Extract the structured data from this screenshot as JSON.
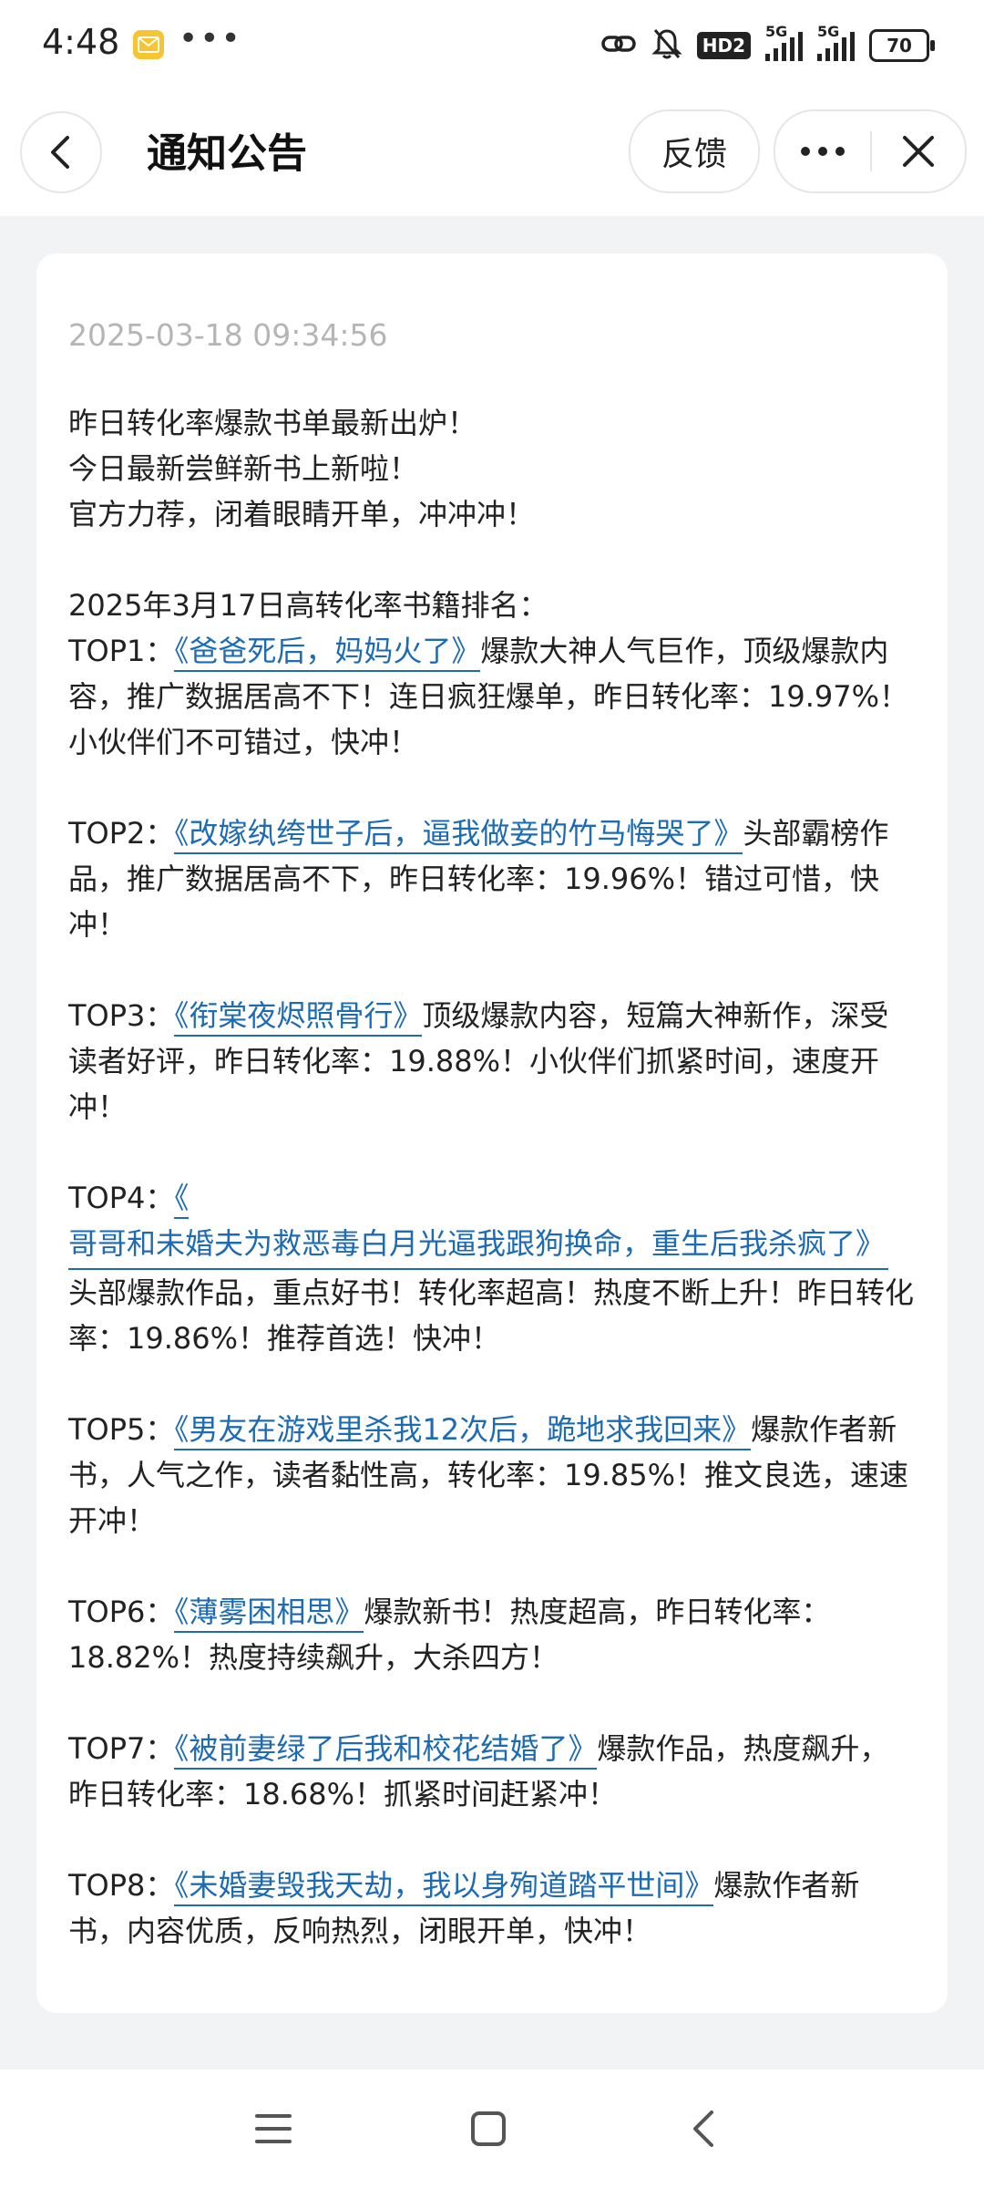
{
  "status_bar": {
    "time": "4:48",
    "more": "•••",
    "hd_label": "HD2",
    "signal1": "5G",
    "signal2": "5G",
    "battery": "70"
  },
  "header": {
    "title": "通知公告",
    "feedback_label": "反馈",
    "menu_icon": "more-dots-icon",
    "close_icon": "close-icon",
    "back_icon": "chevron-left-icon"
  },
  "notice": {
    "date": "2025-03-18 09:34:56",
    "intro": [
      "昨日转化率爆款书单最新出炉！",
      "今日最新尝鲜新书上新啦！",
      "官方力荐，闭着眼睛开单，冲冲冲！"
    ],
    "ranking_title": "2025年3月17日高转化率书籍排名：",
    "items": [
      {
        "rank": "TOP1：",
        "book": "《爸爸死后，妈妈火了》",
        "desc": "爆款大神人气巨作，顶级爆款内容，推广数据居高不下！连日疯狂爆单，昨日转化率：19.97%！小伙伴们不可错过，快冲！"
      },
      {
        "rank": "TOP2：",
        "book": "《改嫁纨绔世子后，逼我做妾的竹马悔哭了》",
        "desc": "头部霸榜作品，推广数据居高不下，昨日转化率：19.96%！错过可惜，快冲！"
      },
      {
        "rank": "TOP3：",
        "book": "《衔棠夜烬照骨行》",
        "desc": "顶级爆款内容，短篇大神新作，深受读者好评，昨日转化率：19.88%！小伙伴们抓紧时间，速度开冲！"
      },
      {
        "rank": "TOP4：",
        "book_open": "《",
        "book_rest": "哥哥和未婚夫为救恶毒白月光逼我跟狗换命，重生后我杀疯了》",
        "desc": "头部爆款作品，重点好书！转化率超高！热度不断上升！昨日转化率：19.86%！推荐首选！快冲！"
      },
      {
        "rank": "TOP5：",
        "book": "《男友在游戏里杀我12次后，跪地求我回来》",
        "desc": "爆款作者新书，人气之作，读者黏性高，转化率：19.85%！推文良选，速速开冲！"
      },
      {
        "rank": "TOP6：",
        "book": "《薄雾困相思》",
        "desc": "爆款新书！热度超高，昨日转化率：18.82%！热度持续飙升，大杀四方！"
      },
      {
        "rank": "TOP7：",
        "book": "《被前妻绿了后我和校花结婚了》",
        "desc": "爆款作品，热度飙升，昨日转化率：18.68%！抓紧时间赶紧冲！"
      },
      {
        "rank": "TOP8：",
        "book": "《未婚妻毁我天劫，我以身殉道踏平世间》",
        "desc": "爆款作者新书，内容优质，反响热烈，闭眼开单，快冲！"
      }
    ]
  },
  "nav_bar": {
    "menu_icon": "hamburger-icon",
    "home_icon": "square-home-icon",
    "back_icon": "triangle-back-icon"
  }
}
